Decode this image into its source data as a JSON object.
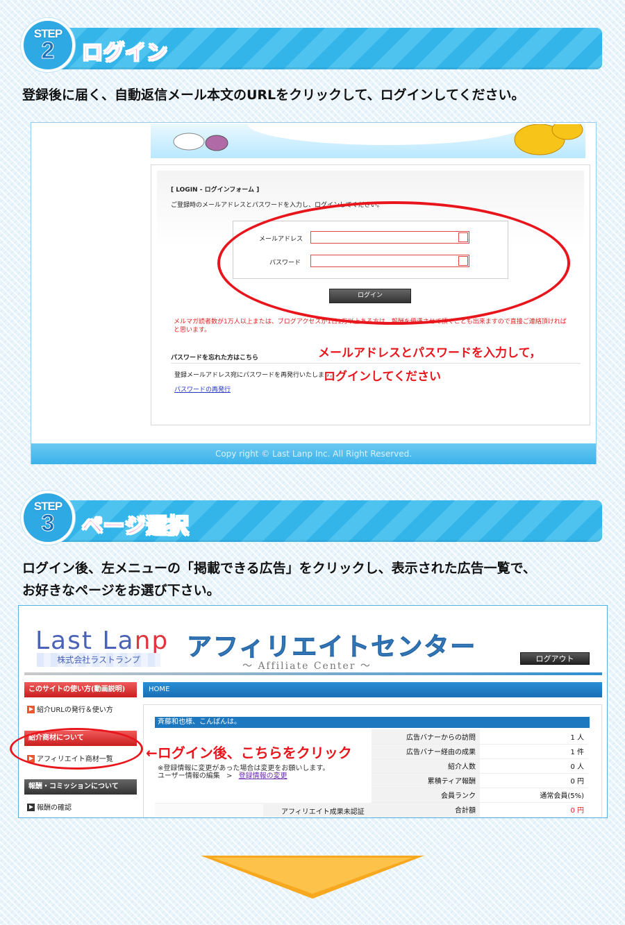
{
  "step2": {
    "label": "STEP",
    "number": "2",
    "title": "ログイン",
    "description": "登録後に届く、自動返信メール本文のURLをクリックして、ログインしてください。",
    "screenshot": {
      "form_heading": "[ LOGIN - ログインフォーム ]",
      "form_intro": "ご登録時のメールアドレスとパスワードを入力し、ログインしてください。",
      "email_label": "メールアドレス",
      "password_label": "パスワード",
      "login_button": "ログイン",
      "notice": "メルマガ読者数が1万人以上または、ブログアクセスが1日1万以上ある方は、報酬を優遇させて頂くことも出来ますので直接ご連絡頂ければと思います。",
      "forgot_heading": "パスワードを忘れた方はこちら",
      "forgot_text": "登録メールアドレス宛にパスワードを再発行いたします。",
      "reissue_link": "パスワードの再発行",
      "copyright": "Copy right © Last Lanp Inc. All Right Reserved.",
      "callout_line1": "メールアドレスとパスワードを入力して，",
      "callout_line2": "ログインしてください"
    }
  },
  "step3": {
    "label": "STEP",
    "number": "3",
    "title": "ページ選択",
    "description_line1": "ログイン後、左メニューの「掲載できる広告」をクリックし、表示された広告一覧で、",
    "description_line2": "お好きなページをお選び下さい。",
    "screenshot": {
      "logo_text_a": "Last La",
      "logo_text_b": "np",
      "logo_company": "株式会社ラストランプ",
      "site_title": "アフィリエイトセンター",
      "site_subtitle": "～ Affiliate Center ～",
      "logout_button": "ログアウト",
      "menu_howto": "このサイトの使い方(動画説明)",
      "menu_howto_link": "紹介URLの発行＆使い方",
      "menu_products": "紹介商材について",
      "menu_products_link": "アフィリエイト商材一覧",
      "menu_rewards": "報酬・コミッションについて",
      "menu_rewards_link": "報酬の確認",
      "breadcrumb": "HOME",
      "greeting": "斉藤和也様、こんばんは。",
      "change_note": "※登録情報に変更があった場合は変更をお願いします。",
      "user_edit": "ユーザー情報の編集",
      "separator": ">",
      "user_change_link": "登録情報の変更",
      "unapproved_label": "アフィリエイト成果未認証",
      "stats": [
        {
          "key": "広告バナーからの訪問",
          "value": "1 人"
        },
        {
          "key": "広告バナー経由の成果",
          "value": "1 件"
        },
        {
          "key": "紹介人数",
          "value": "0 人"
        },
        {
          "key": "累積ティア報酬",
          "value": "0 円"
        },
        {
          "key": "会員ランク",
          "value": "通常会員(5%)"
        },
        {
          "key": "合計額",
          "value": "0 円"
        }
      ],
      "callout": "←ログイン後、こちらをクリック"
    }
  },
  "colors": {
    "step_bar": "#33b5ea",
    "step_title": "#ff2f8f",
    "annotation_red": "#e8161c",
    "arrow_orange": "#f7a81e"
  }
}
